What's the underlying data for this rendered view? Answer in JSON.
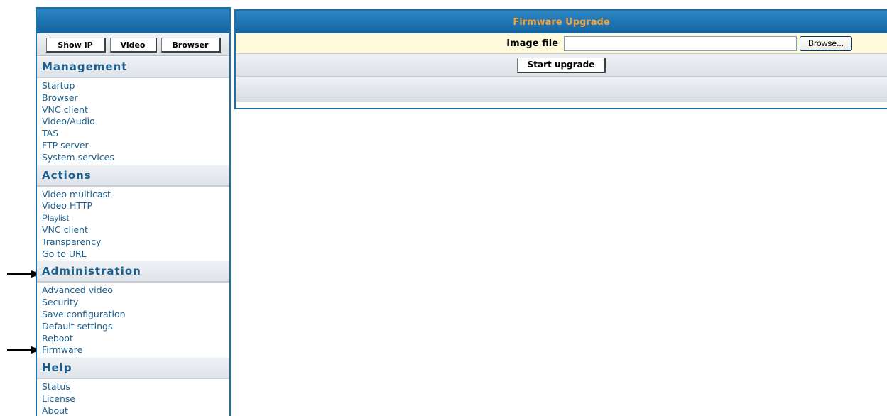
{
  "toolbar": {
    "show_ip": "Show IP",
    "video": "Video",
    "browser": "Browser"
  },
  "sidebar": {
    "sections": [
      {
        "title": "Management",
        "items": [
          "Startup",
          "Browser",
          "VNC client",
          "Video/Audio",
          "TAS",
          "FTP server",
          "System services"
        ]
      },
      {
        "title": "Actions",
        "items": [
          "Video multicast",
          "Video HTTP",
          "Playlist",
          "VNC client",
          "Transparency",
          "Go to URL"
        ]
      },
      {
        "title": "Administration",
        "items": [
          "Advanced video",
          "Security",
          "Save configuration",
          "Default settings",
          "Reboot",
          "Firmware"
        ]
      },
      {
        "title": "Help",
        "items": [
          "Status",
          "License",
          "About"
        ]
      }
    ]
  },
  "main": {
    "title": "Firmware Upgrade",
    "image_file_label": "Image file",
    "image_file_value": "",
    "browse_label": "Browse...",
    "start_upgrade_label": "Start upgrade"
  },
  "colors": {
    "header_blue": "#1d6fa5",
    "link_blue": "#1b5f8e",
    "title_orange": "#f0a23a",
    "input_row_bg": "#fffadc"
  }
}
